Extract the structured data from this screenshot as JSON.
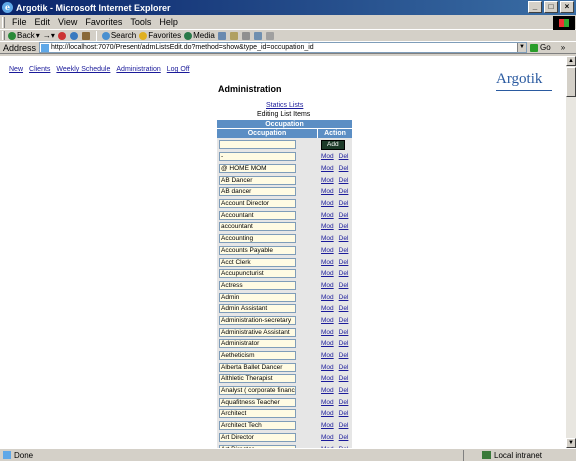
{
  "window": {
    "title": "Argotik - Microsoft Internet Explorer",
    "minimize": "_",
    "maximize": "□",
    "close": "×"
  },
  "menu": [
    "File",
    "Edit",
    "View",
    "Favorites",
    "Tools",
    "Help"
  ],
  "toolbar": {
    "back": "Back",
    "search": "Search",
    "favorites": "Favorites",
    "media": "Media"
  },
  "address": {
    "label": "Address",
    "url": "http://localhost:7070/Present/admListsEdit.do?method=show&type_id=occupation_id",
    "go": "Go",
    "links": "»"
  },
  "page": {
    "nav": [
      "New",
      "Clients",
      "Weekly Schedule",
      "Administration",
      "Log Off"
    ],
    "logo": "Argotik",
    "heading": "Administration",
    "statics_link": "Statics Lists",
    "subheading": "Editing List Items",
    "table": {
      "caption": "Occupation",
      "col_occupation": "Occupation",
      "col_action": "Action",
      "add_label": "Add",
      "mod_label": "Mod",
      "del_label": "Del",
      "rows": [
        "-",
        "@ HOME MOM",
        "AB Dancer",
        "AB dancer",
        "Account Director",
        "Accountant",
        "accountant",
        "Accounting",
        "Accounts Payable",
        "Acct Clerk",
        "Accupuncturist",
        "Actress",
        "Admin",
        "Admin Assistant",
        "Administration-secretary",
        "Administrative Assistant",
        "Administrator",
        "Aetheticism",
        "Alberta Ballet Dancer",
        "Althletic Therapist",
        "Analyst ( corporate finance )",
        "Aquafitness Teacher",
        "Architect",
        "Architect Tech",
        "Art Director",
        "Art Director"
      ]
    }
  },
  "status": {
    "text": "Done",
    "zone": "Local intranet"
  }
}
